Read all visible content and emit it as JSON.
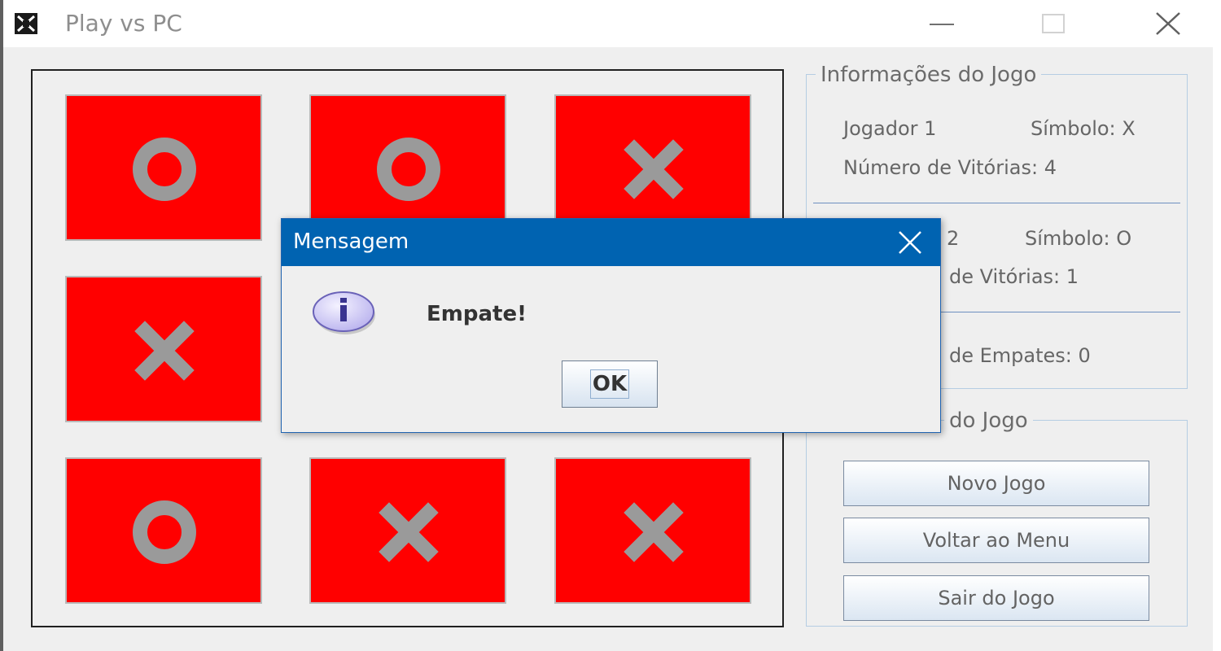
{
  "window": {
    "title": "Play vs PC",
    "icon": "java-duke-icon"
  },
  "colors": {
    "cell_bg": "#ff0000",
    "mark": "#9a9a9a",
    "dialog_title_bg": "#0063b1"
  },
  "board": {
    "cells": [
      "O",
      "O",
      "X",
      "X",
      "",
      "",
      "O",
      "X",
      "X"
    ]
  },
  "info_panel": {
    "legend": "Informações do Jogo",
    "player1": {
      "name": "Jogador 1",
      "symbol": "Símbolo: X",
      "wins": "Número de Vitórias: 4"
    },
    "player2": {
      "name_visible": "2",
      "symbol": "Símbolo: O",
      "wins_visible": "de Vitórias: 1"
    },
    "draws_visible": "de Empates: 0"
  },
  "options_panel": {
    "legend_visible": "do Jogo",
    "buttons": {
      "new_game": "Novo Jogo",
      "back_menu": "Voltar ao Menu",
      "exit_game": "Sair do Jogo"
    }
  },
  "dialog": {
    "title": "Mensagem",
    "message": "Empate!",
    "ok_label": "OK",
    "icon": "info-icon"
  }
}
